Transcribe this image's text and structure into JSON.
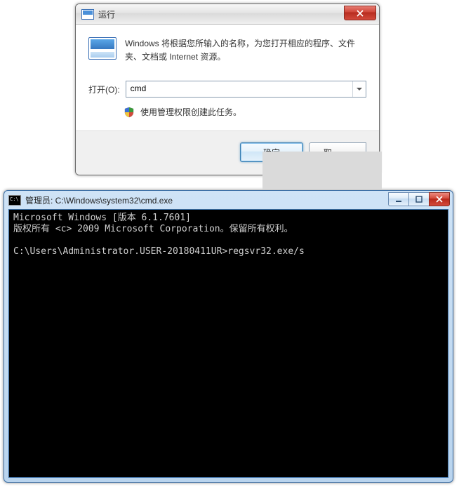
{
  "run": {
    "title": "运行",
    "description": "Windows 将根据您所输入的名称，为您打开相应的程序、文件夹、文档或 Internet 资源。",
    "open_label": "打开(O):",
    "open_value": "cmd",
    "shield_text": "使用管理权限创建此任务。",
    "ok_label": "确定",
    "cancel_label": "取"
  },
  "cmd": {
    "title": "管理员: C:\\Windows\\system32\\cmd.exe",
    "line1": "Microsoft Windows [版本 6.1.7601]",
    "line2": "版权所有 <c> 2009 Microsoft Corporation。保留所有权利。",
    "line3": "",
    "prompt": "C:\\Users\\Administrator.USER-20180411UR>regsvr32.exe/s"
  }
}
